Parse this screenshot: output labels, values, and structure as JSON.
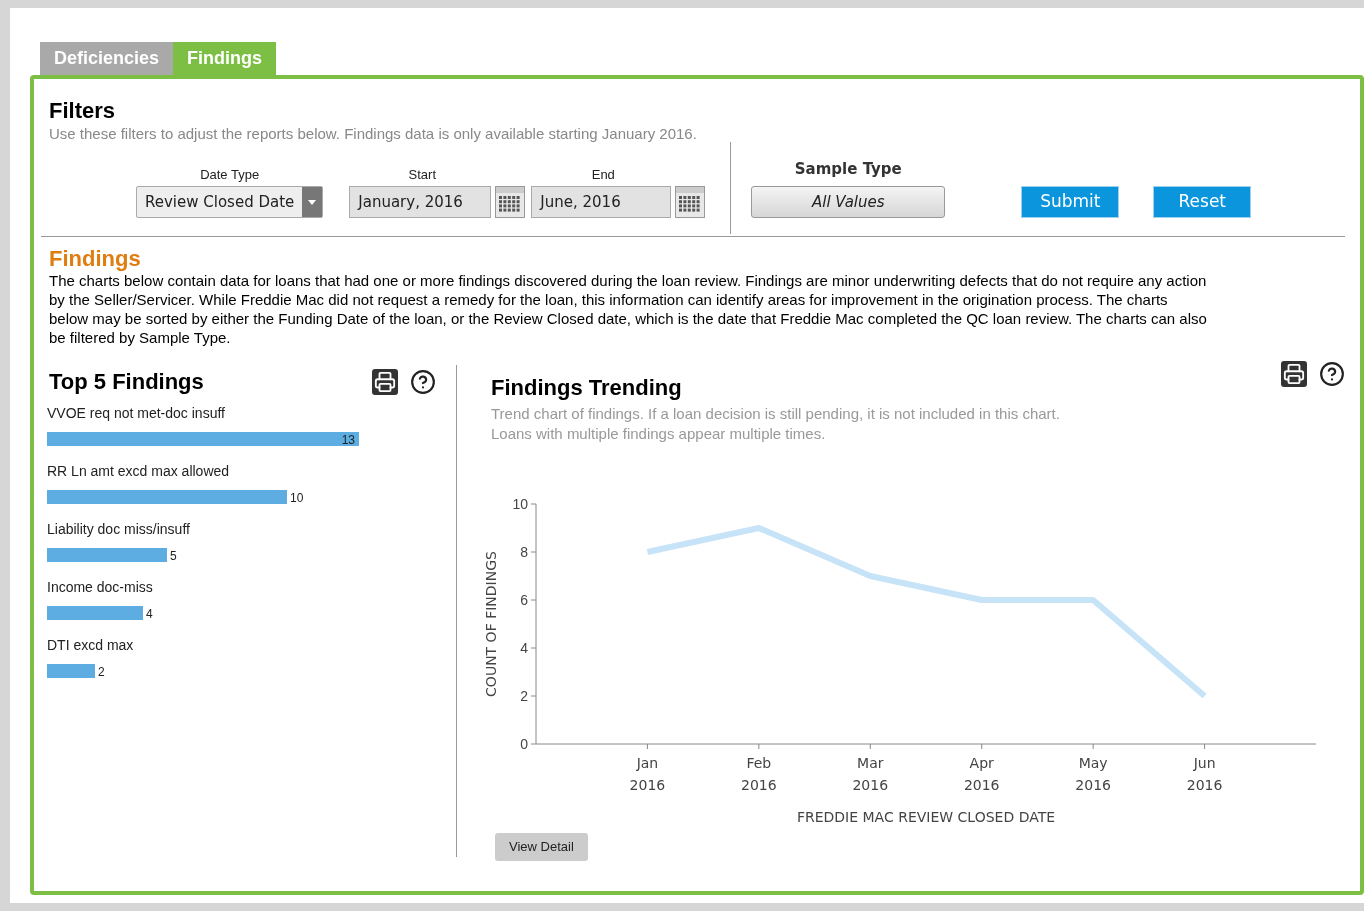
{
  "tabs": [
    {
      "label": "Deficiencies",
      "selected": false
    },
    {
      "label": "Findings",
      "selected": true
    }
  ],
  "filters": {
    "title": "Filters",
    "description": "Use these filters to adjust the reports below.  Findings data is only available starting January 2016.",
    "date_type": {
      "label": "Date Type",
      "value": "Review Closed Date"
    },
    "start": {
      "label": "Start",
      "value": "January, 2016"
    },
    "end": {
      "label": "End",
      "value": "June, 2016"
    },
    "sample_type": {
      "label": "Sample Type",
      "value": "All Values"
    },
    "buttons": [
      "Submit",
      "Reset"
    ]
  },
  "findings": {
    "title": "Findings",
    "description": "The charts below contain data for loans that had one or more findings discovered during the loan review. Findings are minor underwriting defects that do not require any action by the Seller/Servicer.  While Freddie Mac did not request a remedy for the loan, this information can identify areas for improvement in the origination process. The charts below may be sorted by either the Funding Date of the loan, or the Review Closed date, which is the date that Freddie Mac completed the QC loan review. The charts can also be filtered by Sample Type."
  },
  "top_findings": {
    "title": "Top 5 Findings",
    "chart_data": {
      "type": "bar",
      "orientation": "horizontal",
      "categories": [
        "VVOE req not met-doc insuff",
        "RR Ln amt excd max allowed",
        "Liability doc miss/insuff",
        "Income doc-miss",
        "DTI excd max"
      ],
      "series": [
        {
          "color": "#5dade2",
          "values": [
            13,
            10,
            5,
            4,
            2
          ]
        }
      ],
      "data_labels": true
    }
  },
  "trending": {
    "title": "Findings Trending",
    "description": "Trend chart of findings.  If a loan decision is still pending, it is not included in this chart.\nLoans with multiple findings appear multiple times.",
    "chart_data": {
      "type": "line",
      "xlabel": "FREDDIE MAC REVIEW CLOSED DATE",
      "ylabel": "COUNT OF FINDINGS",
      "categories": [
        "Jan\n2016",
        "Feb\n2016",
        "Mar\n2016",
        "Apr\n2016",
        "May\n2016",
        "Jun\n2016"
      ],
      "series": [
        {
          "color": "#c6e3f7",
          "values": [
            8,
            9,
            7,
            6,
            6,
            2
          ]
        }
      ],
      "ylim": [
        0,
        10
      ],
      "yticks": [
        0,
        2,
        4,
        6,
        8,
        10
      ]
    },
    "button": "View Detail"
  }
}
